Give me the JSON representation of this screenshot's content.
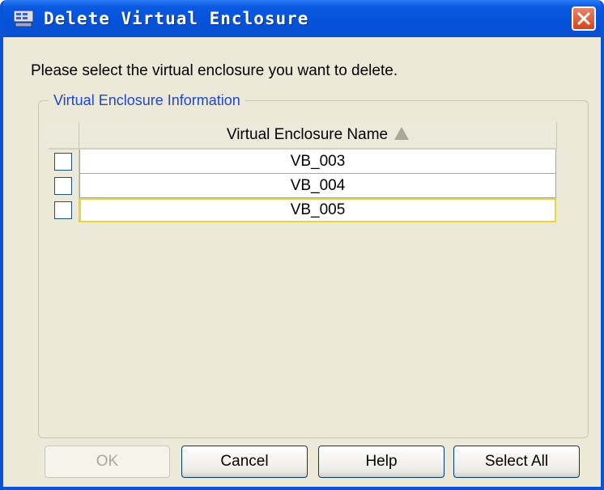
{
  "window": {
    "title": "Delete Virtual Enclosure"
  },
  "prompt": "Please select the virtual enclosure you want to delete.",
  "group": {
    "label": "Virtual Enclosure Information"
  },
  "table": {
    "column_header": "Virtual Enclosure Name",
    "sort": "ascending",
    "rows": [
      {
        "name": "VB_003",
        "checked": false
      },
      {
        "name": "VB_004",
        "checked": false
      },
      {
        "name": "VB_005",
        "checked": false,
        "focused": true
      }
    ]
  },
  "buttons": {
    "ok": "OK",
    "cancel": "Cancel",
    "help": "Help",
    "select_all": "Select All"
  },
  "colors": {
    "titlebar": "#0552d9",
    "accent_text": "#1f47c9",
    "close": "#d2451e",
    "focus": "#e8d63a"
  },
  "icons": [
    "app-icon",
    "close-icon",
    "sort-ascending-icon"
  ]
}
